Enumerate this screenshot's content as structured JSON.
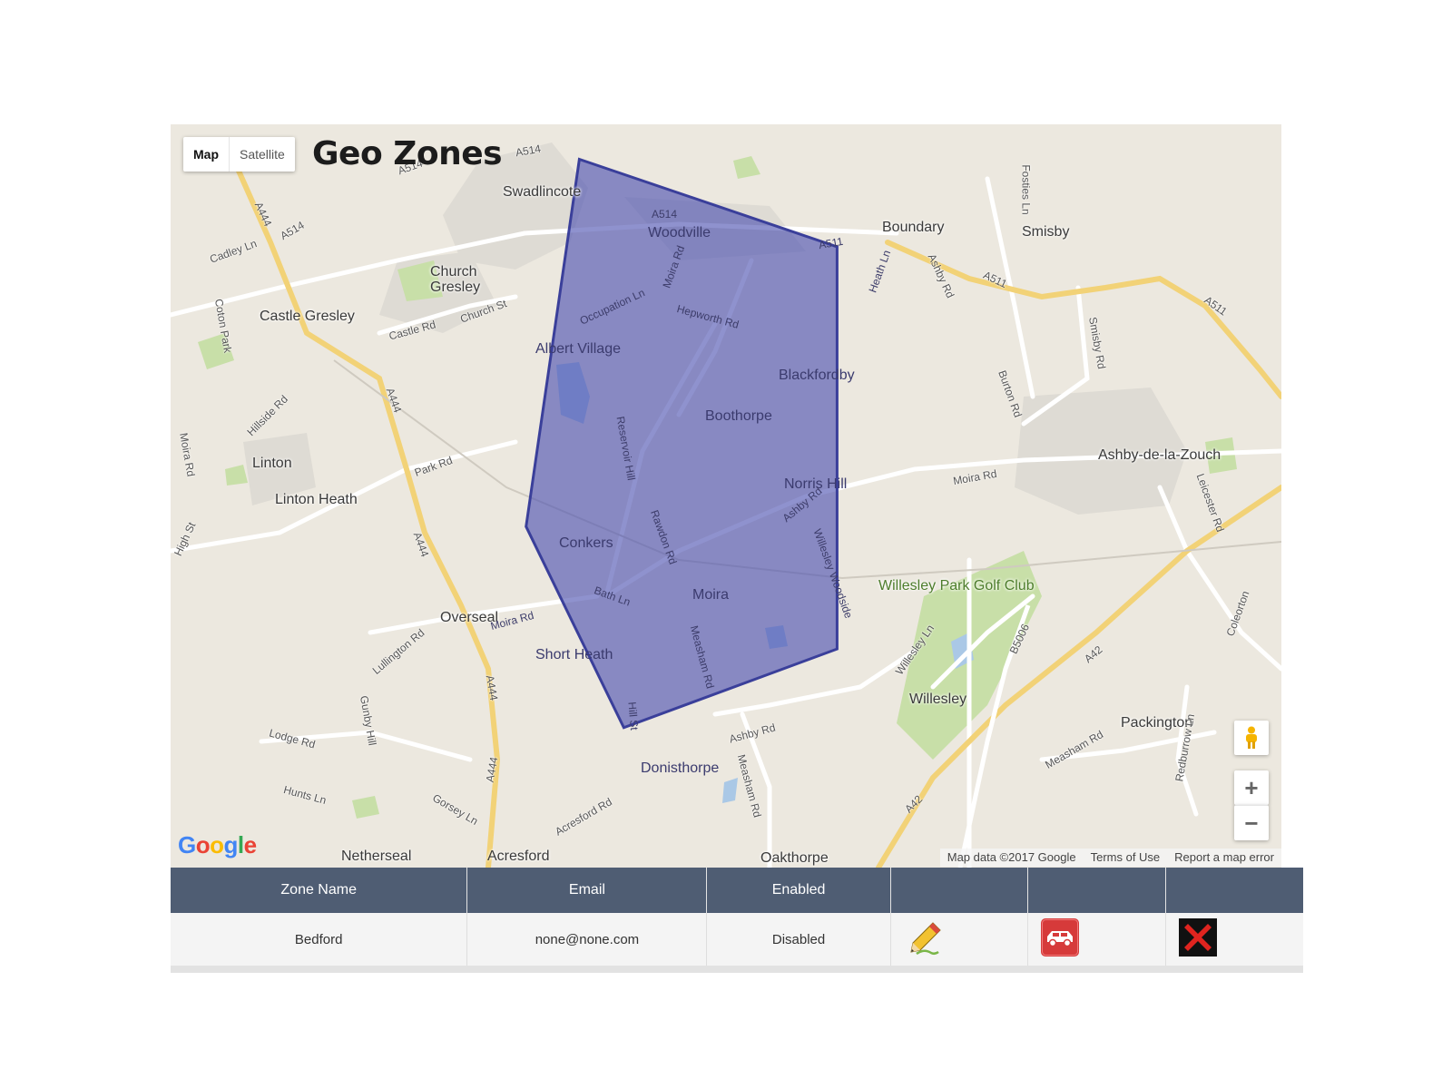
{
  "map": {
    "title": "Geo Zones",
    "type_controls": {
      "map": "Map",
      "satellite": "Satellite",
      "active": "Map"
    },
    "places": [
      {
        "name": "Swadlincote"
      },
      {
        "name": "Woodville"
      },
      {
        "name": "Boundary"
      },
      {
        "name": "Smisby"
      },
      {
        "name": "Church Gresley"
      },
      {
        "name": "Castle Gresley"
      },
      {
        "name": "Albert Village"
      },
      {
        "name": "Blackfordby"
      },
      {
        "name": "Boothorpe"
      },
      {
        "name": "Linton"
      },
      {
        "name": "Linton Heath"
      },
      {
        "name": "Ashby-de-la-Zouch"
      },
      {
        "name": "Norris Hill"
      },
      {
        "name": "Conkers"
      },
      {
        "name": "Willesley Park Golf Club"
      },
      {
        "name": "Moira"
      },
      {
        "name": "Overseal"
      },
      {
        "name": "Short Heath"
      },
      {
        "name": "Willesley"
      },
      {
        "name": "Packington"
      },
      {
        "name": "Donisthorpe"
      },
      {
        "name": "Netherseal"
      },
      {
        "name": "Acresford"
      },
      {
        "name": "Oakthorpe"
      }
    ],
    "roads": [
      "A514",
      "A514",
      "A514",
      "A514",
      "A511",
      "A511",
      "A511",
      "A444",
      "A444",
      "A444",
      "A444",
      "A444",
      "A42",
      "A42",
      "B5006",
      "Cadley Ln",
      "Coton Park",
      "Castle Rd",
      "Church St",
      "Occupation Ln",
      "Moira Rd",
      "Hepworth Rd",
      "Heath Ln",
      "Fosties Ln",
      "Ashby Rd",
      "Smisby Rd",
      "Burton Rd",
      "Moira Rd",
      "Reservoir Hill",
      "Rawdon Rd",
      "Ashby Rd",
      "Willesley Woodside",
      "Leicester Rd",
      "Moira Rd",
      "Hillside Rd",
      "Park Rd",
      "High St",
      "Bath Ln",
      "Moira Rd",
      "Measham Rd",
      "Lullington Rd",
      "Gunby Hill",
      "Lodge Rd",
      "Hunts Ln",
      "Gorsey Ln",
      "Acresford Rd",
      "Hill St",
      "Ashby Rd",
      "Measham Rd",
      "Willesley Ln",
      "Measham Rd",
      "Redburrow Ln",
      "Coleorton"
    ],
    "zone_polygon": [
      {
        "lat": 52.776,
        "lng": -1.558
      },
      {
        "lat": 52.766,
        "lng": -1.5
      },
      {
        "lat": 52.72,
        "lng": -1.5
      },
      {
        "lat": 52.711,
        "lng": -1.548
      },
      {
        "lat": 52.734,
        "lng": -1.57
      }
    ],
    "zone_fill_color": "#4b4fb0",
    "zone_stroke_color": "#3a3f9a",
    "logo": "Google",
    "attribution": {
      "data": "Map data ©2017 Google",
      "terms": "Terms of Use",
      "report": "Report a map error"
    },
    "controls": {
      "zoom_in": "+",
      "zoom_out": "−",
      "street_view": "pegman-icon"
    }
  },
  "table": {
    "headers": [
      "Zone Name",
      "Email",
      "Enabled",
      "",
      "",
      ""
    ],
    "rows": [
      {
        "zone_name": "Bedford",
        "email": "none@none.com",
        "enabled": "Disabled",
        "actions": [
          "edit-pencil-icon",
          "vehicle-car-icon",
          "delete-x-icon"
        ]
      }
    ]
  }
}
